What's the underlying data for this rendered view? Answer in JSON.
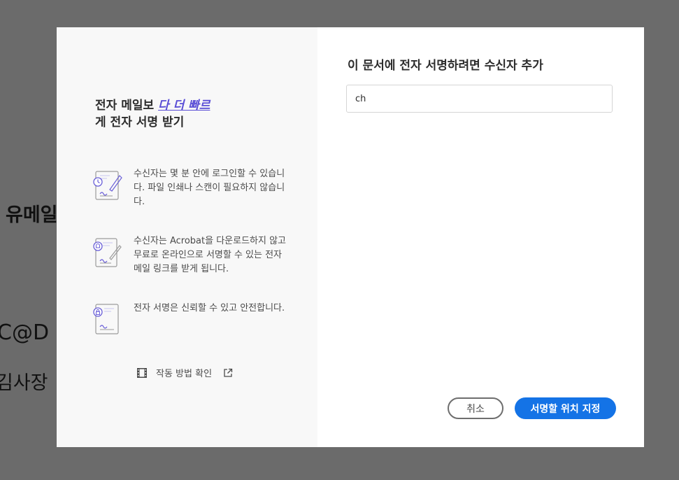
{
  "background": {
    "line1": "유메일",
    "line2": "C@D",
    "line3": "김사장"
  },
  "promo": {
    "title_before": "전자 메일보 ",
    "title_accent": "다 더 빠르",
    "title_after": "게 전자 서명 받기",
    "features": [
      {
        "icon": "stopwatch-signature-icon",
        "text": "수신자는 몇 분 안에 로그인할 수 있습니다. 파일 인쇄나 스캔이 필요하지 않습니다."
      },
      {
        "icon": "bell-document-signature-icon",
        "text": "수신자는 Acrobat을 다운로드하지 않고 무료로 온라인으로 서명할 수 있는 전자 메일 링크를 받게 됩니다."
      },
      {
        "icon": "lock-document-icon",
        "text": "전자 서명은 신뢰할 수 있고 안전합니다."
      }
    ],
    "how_it_works": "작동 방법 확인"
  },
  "form": {
    "title": "이 문서에 전자 서명하려면 수신자 추가",
    "recipient_value": "ch"
  },
  "buttons": {
    "cancel": "취소",
    "primary": "서명할 위치 지정"
  },
  "colors": {
    "accent": "#5a4ed6",
    "primary": "#1473e6",
    "overlay": "#6b6b6b"
  }
}
